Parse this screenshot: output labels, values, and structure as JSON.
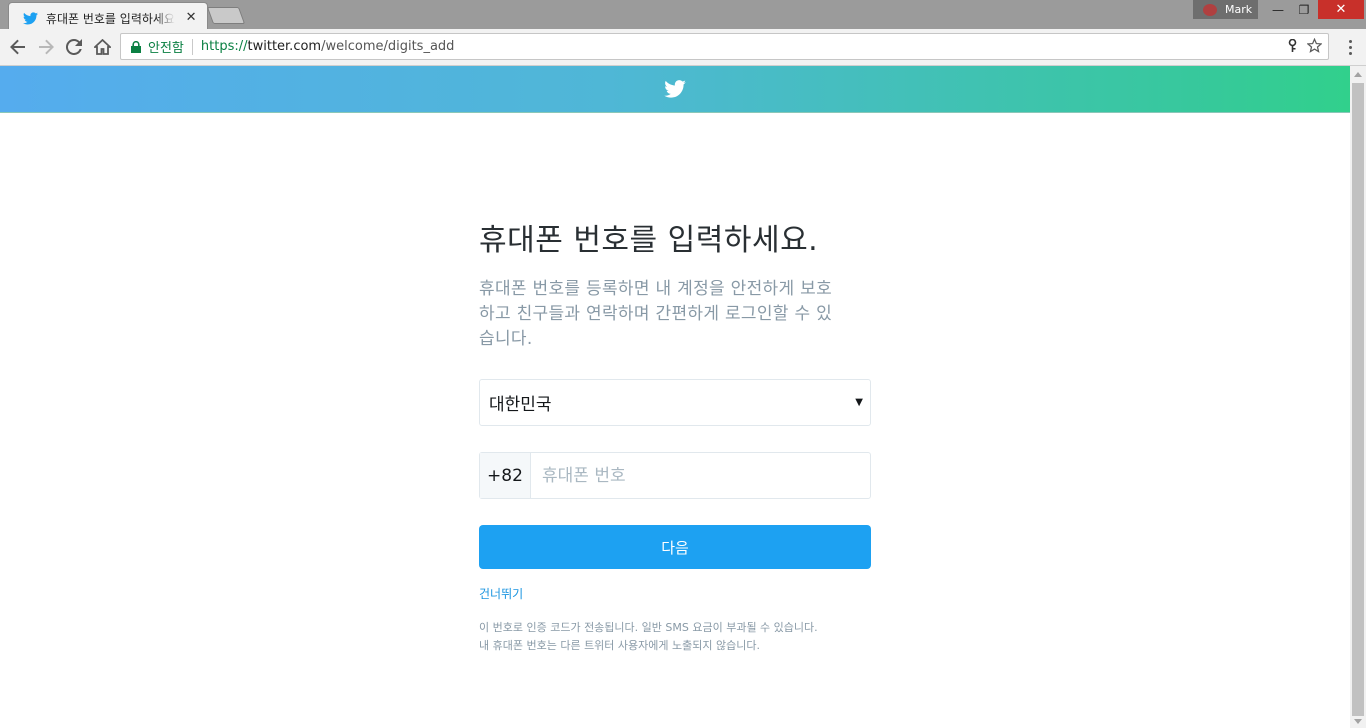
{
  "browser": {
    "tab": {
      "title": "휴대폰 번호를 입력하세요",
      "close": "✕"
    },
    "profile": {
      "name": "Mark"
    },
    "window": {
      "minimize": "—",
      "restore": "❐",
      "close": "✕"
    },
    "omnibox": {
      "secure_label": "안전함",
      "url_scheme": "https://",
      "url_host": "twitter.com",
      "url_path": "/welcome/digits_add"
    }
  },
  "page": {
    "banner": {
      "logo": "twitter-bird-icon",
      "color_left": "#55acee",
      "color_right": "#31d08c"
    },
    "heading": "휴대폰 번호를 입력하세요.",
    "subtext_lines": [
      "휴대폰 번호를 등록하면 내 계정을 안전하게 보호",
      "하고 친구들과 연락하며 간편하게 로그인할 수 있",
      "습니다."
    ],
    "country_select": {
      "value": "대한민국"
    },
    "phone": {
      "prefix": "+82",
      "placeholder": "휴대폰 번호",
      "value": ""
    },
    "next_button": {
      "label": "다음",
      "color": "#1da1f2"
    },
    "skip_link": "건너뛰기",
    "note_lines": [
      "이 번호로 인증 코드가 전송됩니다. 일반 SMS 요금이 부과될 수 있습니다.",
      "내 휴대폰 번호는 다른 트위터 사용자에게 노출되지 않습니다."
    ]
  }
}
